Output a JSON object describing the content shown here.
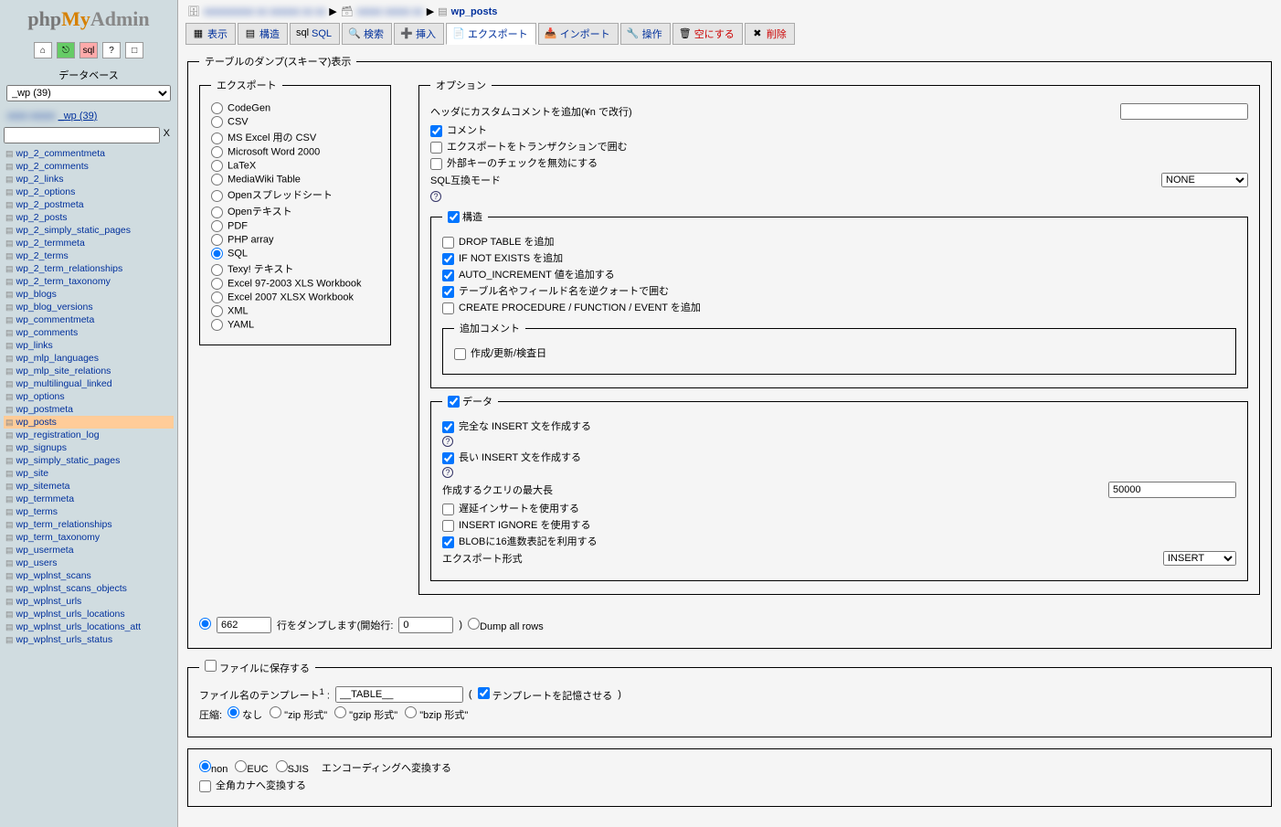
{
  "logo": {
    "p1": "php",
    "p2": "My",
    "p3": "Admin"
  },
  "sidebar": {
    "db_label": "データベース",
    "db_selected": "_wp (39)",
    "db_link_suffix": "_wp (39)",
    "tables": [
      "wp_2_commentmeta",
      "wp_2_comments",
      "wp_2_links",
      "wp_2_options",
      "wp_2_postmeta",
      "wp_2_posts",
      "wp_2_simply_static_pages",
      "wp_2_termmeta",
      "wp_2_terms",
      "wp_2_term_relationships",
      "wp_2_term_taxonomy",
      "wp_blogs",
      "wp_blog_versions",
      "wp_commentmeta",
      "wp_comments",
      "wp_links",
      "wp_mlp_languages",
      "wp_mlp_site_relations",
      "wp_multilingual_linked",
      "wp_options",
      "wp_postmeta",
      "wp_posts",
      "wp_registration_log",
      "wp_signups",
      "wp_simply_static_pages",
      "wp_site",
      "wp_sitemeta",
      "wp_termmeta",
      "wp_terms",
      "wp_term_relationships",
      "wp_term_taxonomy",
      "wp_usermeta",
      "wp_users",
      "wp_wplnst_scans",
      "wp_wplnst_scans_objects",
      "wp_wplnst_urls",
      "wp_wplnst_urls_locations",
      "wp_wplnst_urls_locations_att",
      "wp_wplnst_urls_status"
    ],
    "active_table": "wp_posts"
  },
  "breadcrumb": {
    "table": "wp_posts"
  },
  "tabs": [
    {
      "label": "表示",
      "active": false
    },
    {
      "label": "構造",
      "active": false
    },
    {
      "label": "SQL",
      "active": false
    },
    {
      "label": "検索",
      "active": false
    },
    {
      "label": "挿入",
      "active": false
    },
    {
      "label": "エクスポート",
      "active": true
    },
    {
      "label": "インポート",
      "active": false
    },
    {
      "label": "操作",
      "active": false
    },
    {
      "label": "空にする",
      "active": false,
      "red": true
    },
    {
      "label": "削除",
      "active": false,
      "red": true
    }
  ],
  "main_legend": "テーブルのダンプ(スキーマ)表示",
  "export": {
    "legend": "エクスポート",
    "formats": [
      "CodeGen",
      "CSV",
      "MS Excel 用の CSV",
      "Microsoft Word 2000",
      "LaTeX",
      "MediaWiki Table",
      "Openスプレッドシート",
      "Openテキスト",
      "PDF",
      "PHP array",
      "SQL",
      "Texy! テキスト",
      "Excel 97-2003 XLS Workbook",
      "Excel 2007 XLSX Workbook",
      "XML",
      "YAML"
    ],
    "selected": "SQL"
  },
  "options": {
    "legend": "オプション",
    "header_comment": "ヘッダにカスタムコメントを追加(¥n で改行)",
    "comments": "コメント",
    "transaction": "エクスポートをトランザクションで囲む",
    "disable_fk": "外部キーのチェックを無効にする",
    "sql_compat": "SQL互換モード",
    "sql_compat_value": "NONE",
    "structure": {
      "legend": "構造",
      "drop": "DROP TABLE を追加",
      "ifnotexists": "IF NOT EXISTS を追加",
      "autoinc": "AUTO_INCREMENT 値を追加する",
      "backquote": "テーブル名やフィールド名を逆クォートで囲む",
      "procedure": "CREATE PROCEDURE / FUNCTION / EVENT を追加",
      "addcomment_legend": "追加コメント",
      "addcomment_dates": "作成/更新/検査日"
    },
    "data": {
      "legend": "データ",
      "complete": "完全な INSERT 文を作成する",
      "extended": "長い INSERT 文を作成する",
      "maxlen_label": "作成するクエリの最大長",
      "maxlen_value": "50000",
      "delayed": "遅延インサートを使用する",
      "ignore": "INSERT IGNORE を使用する",
      "blob_hex": "BLOBに16進数表記を利用する",
      "format_label": "エクスポート形式",
      "format_value": "INSERT"
    }
  },
  "dump": {
    "rows_value": "662",
    "mid_label": "行をダンプします(開始行:",
    "start_value": "0",
    "close": ")",
    "all": "Dump all rows"
  },
  "save": {
    "legend": "ファイルに保存する",
    "template_label": "ファイル名のテンプレート",
    "template_value": "__TABLE__",
    "remember": "テンプレートを記憶させる",
    "compress_label": "圧縮:",
    "compress": [
      "なし",
      "\"zip 形式\"",
      "\"gzip 形式\"",
      "\"bzip 形式\""
    ]
  },
  "encoding": {
    "options": [
      "non",
      "EUC",
      "SJIS"
    ],
    "convert_label": "エンコーディングへ変換する",
    "zenkaku": "全角カナへ変換する"
  }
}
